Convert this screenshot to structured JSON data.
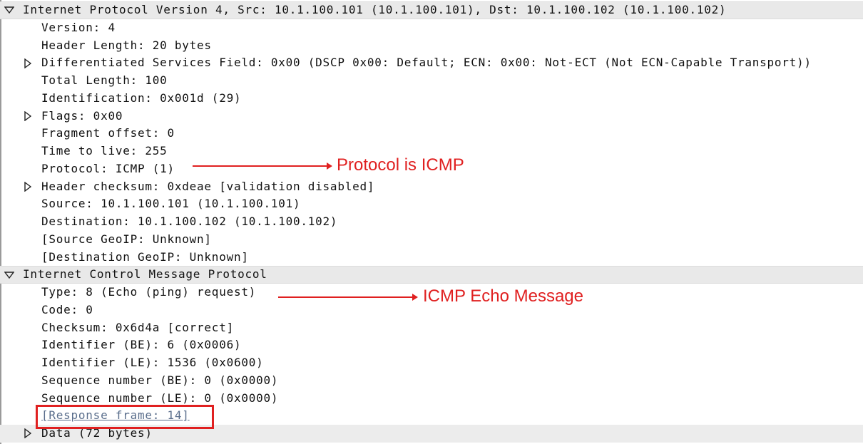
{
  "tree": {
    "ip": {
      "header": "Internet Protocol Version 4, Src: 10.1.100.101 (10.1.100.101), Dst: 10.1.100.102 (10.1.100.102)",
      "version": "Version: 4",
      "header_length": "Header Length: 20 bytes",
      "dsf": "Differentiated Services Field: 0x00 (DSCP 0x00: Default; ECN: 0x00: Not-ECT (Not ECN-Capable Transport))",
      "total_length": "Total Length: 100",
      "identification": "Identification: 0x001d (29)",
      "flags": "Flags: 0x00",
      "fragment_offset": "Fragment offset: 0",
      "ttl": "Time to live: 255",
      "protocol": "Protocol: ICMP (1)",
      "checksum": "Header checksum: 0xdeae [validation disabled]",
      "source": "Source: 10.1.100.101 (10.1.100.101)",
      "destination": "Destination: 10.1.100.102 (10.1.100.102)",
      "source_geoip": "[Source GeoIP: Unknown]",
      "destination_geoip": "[Destination GeoIP: Unknown]"
    },
    "icmp": {
      "header": "Internet Control Message Protocol",
      "type": "Type: 8 (Echo (ping) request)",
      "code": "Code: 0",
      "checksum": "Checksum: 0x6d4a [correct]",
      "identifier_be": "Identifier (BE): 6 (0x0006)",
      "identifier_le": "Identifier (LE): 1536 (0x0600)",
      "seq_be": "Sequence number (BE): 0 (0x0000)",
      "seq_le": "Sequence number (LE): 0 (0x0000)",
      "response_frame": "[Response frame: 14]",
      "data": "Data (72 bytes)"
    }
  },
  "annotations": {
    "protocol_note": "Protocol is ICMP",
    "echo_note": "ICMP Echo Message"
  },
  "colors": {
    "annotation": "#e02020",
    "header_bg": "#e9e9e9",
    "link": "#5a6e8c"
  }
}
